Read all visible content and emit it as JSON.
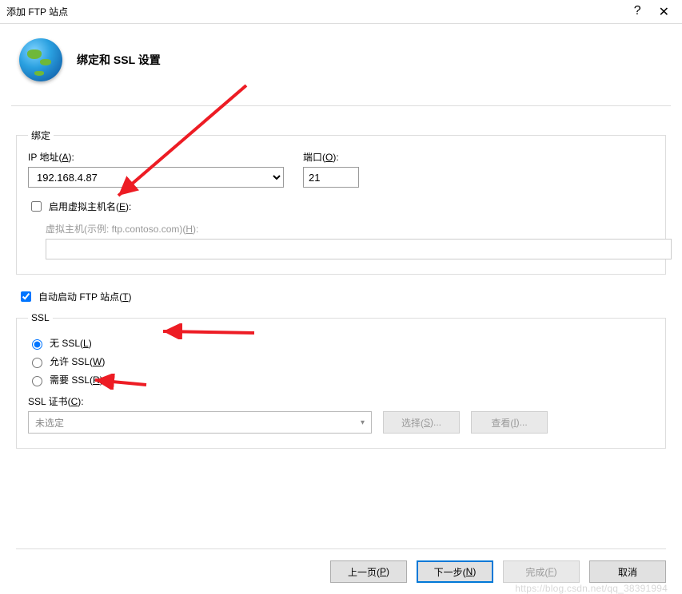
{
  "titlebar": {
    "title": "添加 FTP 站点"
  },
  "header": {
    "title": "绑定和 SSL 设置"
  },
  "binding": {
    "legend": "绑定",
    "ip_label_pre": "IP 地址(",
    "ip_label_key": "A",
    "ip_label_post": "):",
    "ip_value": "192.168.4.87",
    "port_label_pre": "端口(",
    "port_label_key": "O",
    "port_label_post": "):",
    "port_value": "21",
    "enable_vhost_label_pre": "启用虚拟主机名(",
    "enable_vhost_label_key": "E",
    "enable_vhost_label_post": "):",
    "enable_vhost_checked": false,
    "vhost_label_pre": "虚拟主机(示例: ftp.contoso.com)(",
    "vhost_label_key": "H",
    "vhost_label_post": "):",
    "vhost_value": ""
  },
  "autostart": {
    "label_pre": "自动启动 FTP 站点(",
    "label_key": "T",
    "label_post": ")",
    "checked": true
  },
  "ssl": {
    "legend": "SSL",
    "options": {
      "none": {
        "pre": "无 SSL(",
        "key": "L",
        "post": ")"
      },
      "allow": {
        "pre": "允许 SSL(",
        "key": "W",
        "post": ")"
      },
      "require": {
        "pre": "需要 SSL(",
        "key": "R",
        "post": ")"
      }
    },
    "selected": "none",
    "cert_label_pre": "SSL 证书(",
    "cert_label_key": "C",
    "cert_label_post": "):",
    "cert_value": "未选定",
    "select_button_pre": "选择(",
    "select_button_key": "S",
    "select_button_post": ")...",
    "view_button_pre": "查看(",
    "view_button_key": "I",
    "view_button_post": ")..."
  },
  "footer": {
    "prev_pre": "上一页(",
    "prev_key": "P",
    "prev_post": ")",
    "next_pre": "下一步(",
    "next_key": "N",
    "next_post": ")",
    "finish_pre": "完成(",
    "finish_key": "F",
    "finish_post": ")",
    "cancel": "取消"
  },
  "watermark": "https://blog.csdn.net/qq_38391994",
  "annotations": {
    "arrow_color": "#ed1c24"
  }
}
